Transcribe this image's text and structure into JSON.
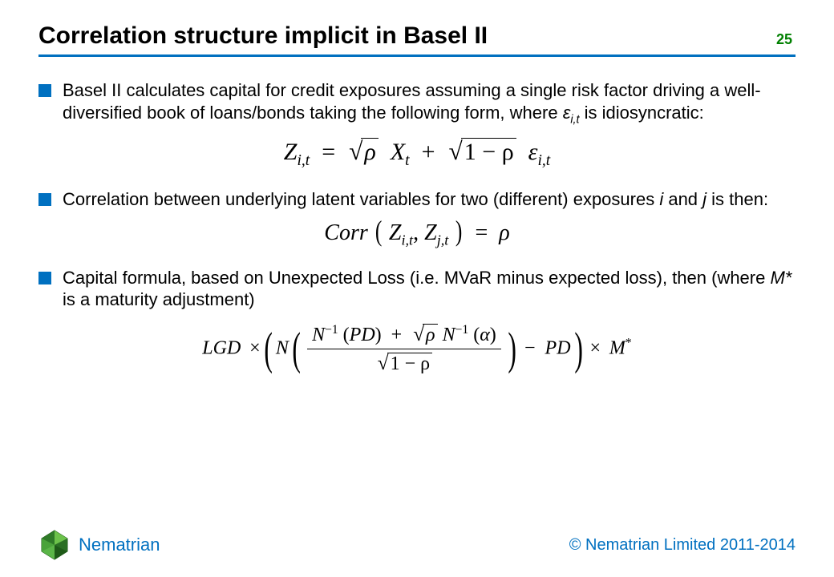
{
  "header": {
    "title": "Correlation structure implicit in Basel II",
    "slide_number": "25"
  },
  "bullets": [
    {
      "text_pre": "Basel II calculates capital for credit exposures assuming a single risk factor driving a well-diversified book of loans/bonds taking the following form, where ",
      "text_var": "ε",
      "text_sub": "i,t",
      "text_post": " is idiosyncratic:"
    },
    {
      "text_pre": "Correlation between underlying latent variables for two (different) exposures ",
      "text_var": "i",
      "text_mid": " and ",
      "text_var2": "j",
      "text_post": " is then:"
    },
    {
      "text_pre": "Capital formula, based on Unexpected Loss (i.e. MVaR minus expected loss), then (where ",
      "text_var": "M*",
      "text_post": " is a maturity adjustment)"
    }
  ],
  "equations": {
    "eq1": {
      "latex": "Z_{i,t} = \\sqrt{\\rho}\\, X_t + \\sqrt{1-\\rho}\\, \\varepsilon_{i,t}",
      "Z": "Z",
      "Z_sub": "i,t",
      "eq": "=",
      "rho": "ρ",
      "X": "X",
      "X_sub": "t",
      "plus": "+",
      "one_minus_rho": "1 − ρ",
      "eps": "ε",
      "eps_sub": "i,t"
    },
    "eq2": {
      "latex": "Corr(Z_{i,t}, Z_{j,t}) = \\rho",
      "Corr": "Corr",
      "Z1": "Z",
      "Z1_sub": "i,t",
      "comma": ",",
      "Z2": "Z",
      "Z2_sub": "j,t",
      "eq": "=",
      "rho": "ρ"
    },
    "eq3": {
      "latex": "LGD \\times \\left( N\\left( \\frac{N^{-1}(PD) + \\sqrt{\\rho}\\, N^{-1}(\\alpha)}{\\sqrt{1-\\rho}} \\right) - PD \\right) \\times M^{*}",
      "LGD": "LGD",
      "times": "×",
      "N": "N",
      "Ninv": "N",
      "neg1": "−1",
      "PD": "PD",
      "plus": "+",
      "rho": "ρ",
      "alpha": "α",
      "one_minus_rho": "1 − ρ",
      "minus": "−",
      "M": "M",
      "star": "*"
    }
  },
  "footer": {
    "brand": "Nematrian",
    "copyright": "© Nematrian Limited 2011-2014"
  }
}
